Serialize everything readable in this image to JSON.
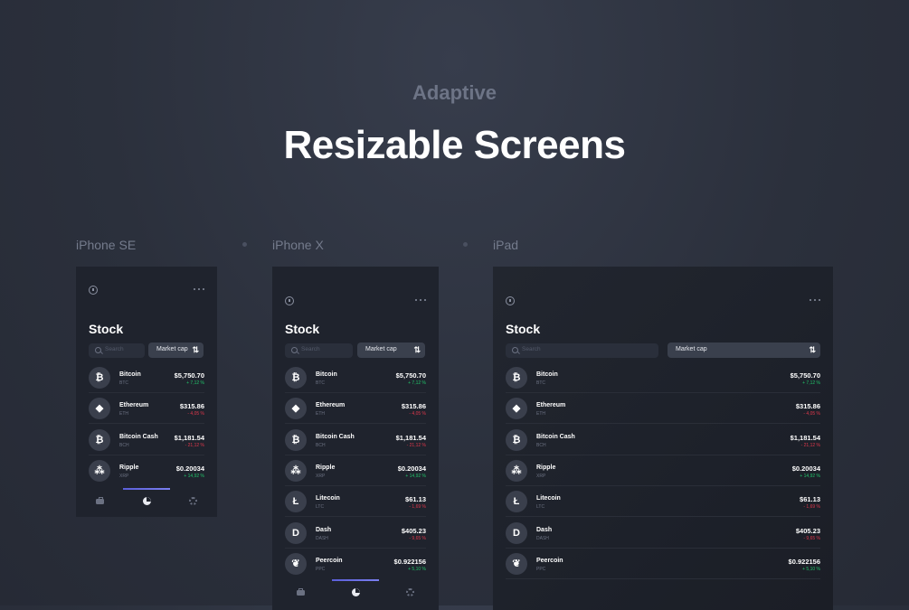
{
  "header": {
    "kicker": "Adaptive",
    "title": "Resizable Screens"
  },
  "devices": [
    {
      "label": "iPhone SE"
    },
    {
      "label": "iPhone X"
    },
    {
      "label": "iPad"
    }
  ],
  "app": {
    "title": "Stock",
    "search_placeholder": "Search",
    "sort_label": "Market cap",
    "sort_icon": "⇅",
    "coins": [
      {
        "name": "Bitcoin",
        "symbol": "BTC",
        "price": "$5,750.70",
        "change": "+ 7,12 %",
        "direction": "up",
        "icon": "₿"
      },
      {
        "name": "Ethereum",
        "symbol": "ETH",
        "price": "$315.86",
        "change": "- 4,05 %",
        "direction": "down",
        "icon": "◆"
      },
      {
        "name": "Bitcoin Cash",
        "symbol": "BCH",
        "price": "$1,181.54",
        "change": "- 21,12 %",
        "direction": "down",
        "icon": "₿"
      },
      {
        "name": "Ripple",
        "symbol": "XRP",
        "price": "$0.20034",
        "change": "+ 14,92 %",
        "direction": "up",
        "icon": "⁂"
      },
      {
        "name": "Litecoin",
        "symbol": "LTC",
        "price": "$61.13",
        "change": "- 1,69 %",
        "direction": "down",
        "icon": "Ł"
      },
      {
        "name": "Dash",
        "symbol": "DASH",
        "price": "$405.23",
        "change": "- 9,65 %",
        "direction": "down",
        "icon": "D"
      },
      {
        "name": "Peercoin",
        "symbol": "PPC",
        "price": "$0.922156",
        "change": "+ 5,10 %",
        "direction": "up",
        "icon": "❦"
      }
    ],
    "tabs": [
      "briefcase-icon",
      "pie-chart-icon",
      "gear-icon"
    ],
    "colors": {
      "up": "#22c36a",
      "down": "#e0384c",
      "accent": "#6b6ff0"
    }
  }
}
